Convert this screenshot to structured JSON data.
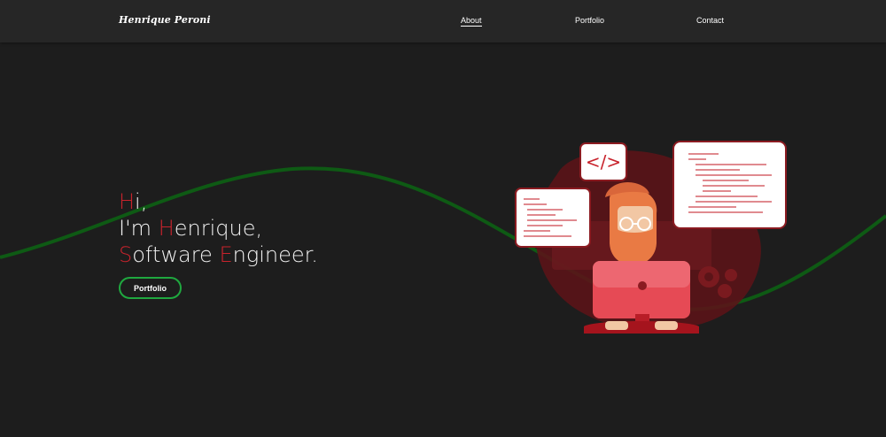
{
  "header": {
    "logo": "Henrique Peroni",
    "nav": [
      {
        "label": "About",
        "active": true
      },
      {
        "label": "Portfolio",
        "active": false
      },
      {
        "label": "Contact",
        "active": false
      }
    ]
  },
  "hero": {
    "line1": {
      "first": "H",
      "rest": "i,"
    },
    "line2": {
      "prefix": "I'm ",
      "first": "H",
      "rest": "enrique,"
    },
    "line3": {
      "first1": "S",
      "rest1": "oftware ",
      "first2": "E",
      "rest2": "ngineer."
    },
    "button_label": "Portfolio"
  },
  "illustration": {
    "code_symbol": "</>",
    "icons": [
      "code-icon",
      "gear-icon",
      "monitor-icon",
      "developer-avatar-icon"
    ]
  },
  "colors": {
    "background": "#1d1d1d",
    "navbar": "#262626",
    "accent_red": "#c8232c",
    "accent_green": "#1fa83f",
    "wave": "#0e5a14"
  }
}
